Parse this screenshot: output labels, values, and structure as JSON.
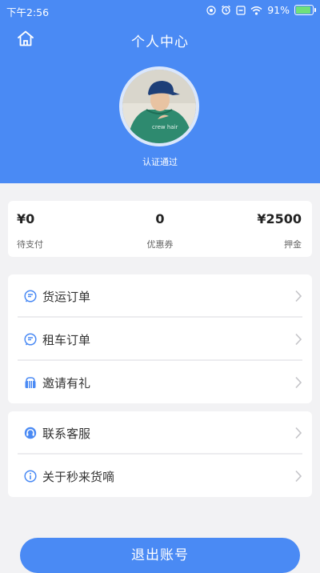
{
  "status_bar": {
    "time": "下午2:56",
    "battery": "91%"
  },
  "header": {
    "title": "个人中心",
    "verify_status": "认证通过"
  },
  "stats": [
    {
      "value": "¥0",
      "label": "待支付"
    },
    {
      "value": "0",
      "label": "优惠券"
    },
    {
      "value": "¥2500",
      "label": "押金"
    }
  ],
  "menu_group_1": [
    {
      "label": "货运订单",
      "icon": "order-icon"
    },
    {
      "label": "租车订单",
      "icon": "order-icon"
    },
    {
      "label": "邀请有礼",
      "icon": "gift-icon"
    }
  ],
  "menu_group_2": [
    {
      "label": "联系客服",
      "icon": "headset-icon"
    },
    {
      "label": "关于秒来货嘀",
      "icon": "info-icon"
    }
  ],
  "logout_label": "退出账号",
  "colors": {
    "primary": "#4a8af4",
    "background": "#f2f2f4"
  }
}
